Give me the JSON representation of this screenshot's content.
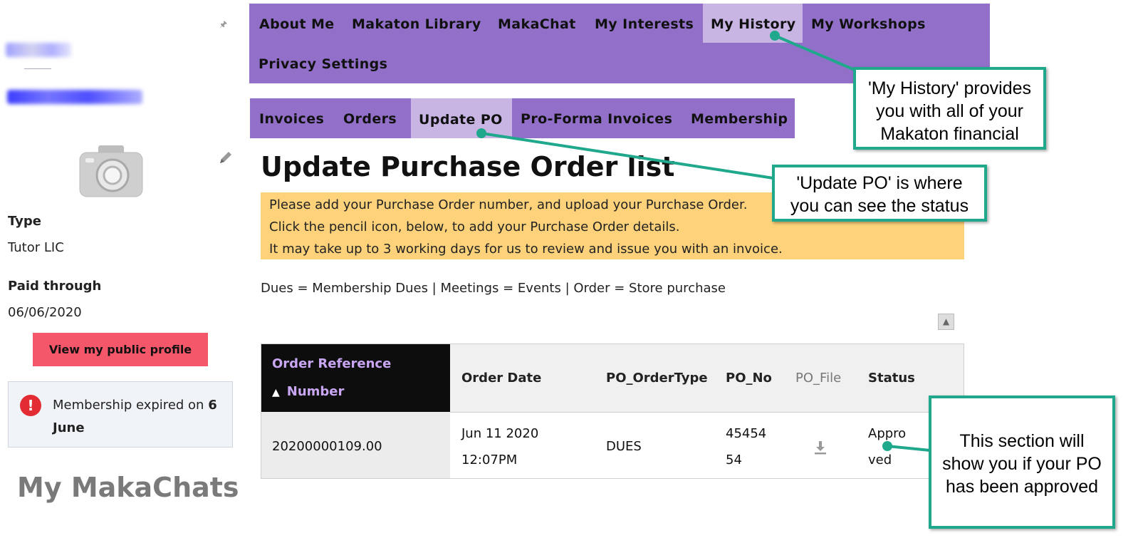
{
  "sidebar": {
    "type_label": "Type",
    "type_value": "Tutor LIC",
    "paid_label": "Paid through",
    "paid_value": "06/06/2020",
    "profile_button": "View my public profile",
    "expired_text_prefix": "Membership expired on ",
    "expired_text_date": "6 June",
    "makachats_title": "My MakaChats"
  },
  "topnav": {
    "tabs": [
      "About Me",
      "Makaton Library",
      "MakaChat",
      "My Interests",
      "My History",
      "My Workshops",
      "Privacy Settings"
    ],
    "active": "My History"
  },
  "subnav": {
    "tabs": [
      "Invoices",
      "Orders",
      "Update PO",
      "Pro-Forma Invoices",
      "Membership"
    ],
    "active": "Update PO"
  },
  "main": {
    "title": "Update Purchase Order list",
    "notice": [
      "Please add your Purchase Order number, and upload your Purchase Order.",
      "Click the pencil icon, below, to add your Purchase Order details.",
      "It may take up to 3 working days for us to review and issue you with an invoice."
    ],
    "legend": "Dues = Membership Dues | Meetings = Events | Order = Store purchase"
  },
  "table": {
    "headers": {
      "order_ref_line1": "Order Reference",
      "order_ref_line2": "Number",
      "sort_glyph": "▲",
      "order_date": "Order Date",
      "po_ordertype": "PO_OrderType",
      "po_no": "PO_No",
      "po_file": "PO_File",
      "status": "Status"
    },
    "rows": [
      {
        "order_ref": "20200000109.00",
        "date_line1": "Jun 11 2020",
        "date_line2": "12:07PM",
        "po_ordertype": "DUES",
        "po_no_line1": "45454",
        "po_no_line2": "54",
        "status_line1": "Appro",
        "status_line2": "ved"
      }
    ]
  },
  "callouts": {
    "history": [
      "'My History' provides",
      "you with all of your",
      "Makaton financial"
    ],
    "update_po": [
      "'Update PO' is where",
      "you can see the status"
    ],
    "status": [
      "This section will",
      "show you if your PO",
      "has been approved"
    ]
  },
  "colors": {
    "nav_bg": "#9270c9",
    "nav_active": "#c9b5e4",
    "notice_bg": "#fdd27a",
    "callout_border": "#1fa88b",
    "profile_button": "#f4566a"
  },
  "icons": [
    "pin-icon",
    "camera-icon",
    "pencil-icon",
    "alert-icon",
    "sort-up-icon",
    "download-icon",
    "scroll-up-icon"
  ]
}
